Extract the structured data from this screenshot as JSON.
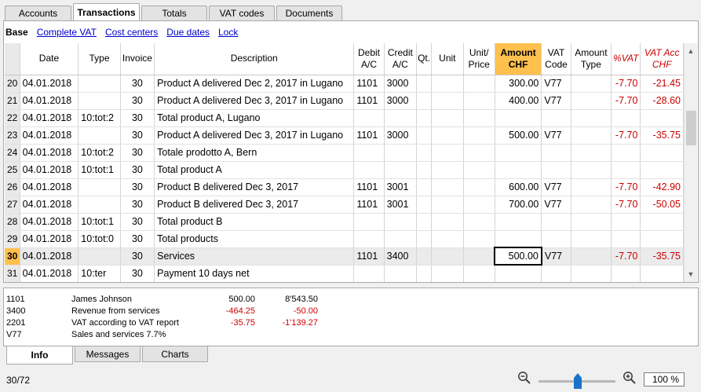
{
  "top_tabs": [
    "Accounts",
    "Transactions",
    "Totals",
    "VAT codes",
    "Documents"
  ],
  "views": [
    "Base",
    "Complete VAT",
    "Cost centers",
    "Due dates",
    "Lock"
  ],
  "columns": {
    "date": "Date",
    "type": "Type",
    "invoice": "Invoice",
    "description": "Description",
    "debit": [
      "Debit",
      "A/C"
    ],
    "credit": [
      "Credit",
      "A/C"
    ],
    "qty": "Qt.",
    "unit": "Unit",
    "unit_price": [
      "Unit/",
      "Price"
    ],
    "amount": [
      "Amount",
      "CHF"
    ],
    "vat_code": [
      "VAT",
      "Code"
    ],
    "amount_type": [
      "Amount",
      "Type"
    ],
    "pct_vat": "%VAT",
    "vat_acc": [
      "VAT Acc",
      "CHF"
    ]
  },
  "rows": [
    {
      "n": "20",
      "date": "04.01.2018",
      "type": "",
      "inv": "30",
      "desc": "Product A delivered Dec 2, 2017 in Lugano",
      "debit": "1101",
      "credit": "3000",
      "amount": "300.00",
      "vat": "V77",
      "pct": "-7.70",
      "vatacc": "-21.45"
    },
    {
      "n": "21",
      "date": "04.01.2018",
      "type": "",
      "inv": "30",
      "desc": "Product A delivered Dec 3, 2017 in Lugano",
      "debit": "1101",
      "credit": "3000",
      "amount": "400.00",
      "vat": "V77",
      "pct": "-7.70",
      "vatacc": "-28.60"
    },
    {
      "n": "22",
      "date": "04.01.2018",
      "type": "10:tot:2",
      "inv": "30",
      "desc": "Total product A, Lugano",
      "debit": "",
      "credit": "",
      "amount": "",
      "vat": "",
      "pct": "",
      "vatacc": ""
    },
    {
      "n": "23",
      "date": "04.01.2018",
      "type": "",
      "inv": "30",
      "desc": "Product A delivered Dec 3, 2017 in Lugano",
      "debit": "1101",
      "credit": "3000",
      "amount": "500.00",
      "vat": "V77",
      "pct": "-7.70",
      "vatacc": "-35.75"
    },
    {
      "n": "24",
      "date": "04.01.2018",
      "type": "10:tot:2",
      "inv": "30",
      "desc": "Totale prodotto A, Bern",
      "debit": "",
      "credit": "",
      "amount": "",
      "vat": "",
      "pct": "",
      "vatacc": ""
    },
    {
      "n": "25",
      "date": "04.01.2018",
      "type": "10:tot:1",
      "inv": "30",
      "desc": "Total product A",
      "debit": "",
      "credit": "",
      "amount": "",
      "vat": "",
      "pct": "",
      "vatacc": ""
    },
    {
      "n": "26",
      "date": "04.01.2018",
      "type": "",
      "inv": "30",
      "desc": "Product B delivered Dec 3, 2017",
      "debit": "1101",
      "credit": "3001",
      "amount": "600.00",
      "vat": "V77",
      "pct": "-7.70",
      "vatacc": "-42.90"
    },
    {
      "n": "27",
      "date": "04.01.2018",
      "type": "",
      "inv": "30",
      "desc": "Product B delivered Dec 3, 2017",
      "debit": "1101",
      "credit": "3001",
      "amount": "700.00",
      "vat": "V77",
      "pct": "-7.70",
      "vatacc": "-50.05"
    },
    {
      "n": "28",
      "date": "04.01.2018",
      "type": "10:tot:1",
      "inv": "30",
      "desc": "Total product B",
      "debit": "",
      "credit": "",
      "amount": "",
      "vat": "",
      "pct": "",
      "vatacc": ""
    },
    {
      "n": "29",
      "date": "04.01.2018",
      "type": "10:tot:0",
      "inv": "30",
      "desc": "Total products",
      "debit": "",
      "credit": "",
      "amount": "",
      "vat": "",
      "pct": "",
      "vatacc": ""
    },
    {
      "n": "30",
      "date": "04.01.2018",
      "type": "",
      "inv": "30",
      "desc": "Services",
      "debit": "1101",
      "credit": "3400",
      "amount": "500.00",
      "vat": "V77",
      "pct": "-7.70",
      "vatacc": "-35.75",
      "selected": true
    },
    {
      "n": "31",
      "date": "04.01.2018",
      "type": "10:ter",
      "inv": "30",
      "desc": "Payment 10 days net",
      "debit": "",
      "credit": "",
      "amount": "",
      "vat": "",
      "pct": "",
      "vatacc": ""
    }
  ],
  "info": [
    {
      "code": "1101",
      "name": "James Johnson",
      "v1": "500.00",
      "v2": "8'543.50",
      "neg1": false,
      "neg2": false
    },
    {
      "code": "3400",
      "name": "Revenue from services",
      "v1": "-464.25",
      "v2": "-50.00",
      "neg1": true,
      "neg2": true
    },
    {
      "code": "2201",
      "name": "VAT according to VAT report",
      "v1": "-35.75",
      "v2": "-1'139.27",
      "neg1": true,
      "neg2": true
    },
    {
      "code": "V77",
      "name": "Sales and services 7.7%",
      "v1": "",
      "v2": "",
      "neg1": false,
      "neg2": false
    }
  ],
  "bottom_tabs": [
    "Info",
    "Messages",
    "Charts"
  ],
  "status_text": "30/72",
  "zoom": "100 %",
  "colors": {
    "amount_header": "#ffc04d",
    "negative": "#cc0000",
    "link": "#0000cc"
  }
}
